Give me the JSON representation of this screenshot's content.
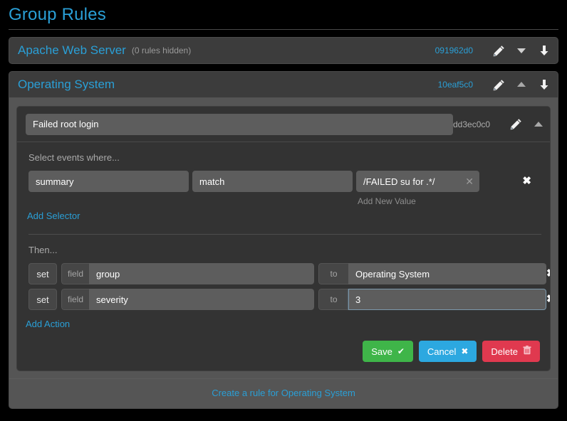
{
  "page": {
    "title": "Group Rules"
  },
  "groups": [
    {
      "name": "Apache Web Server",
      "hidden_note": "(0 rules hidden)",
      "id": "091962d0",
      "collapsed": true,
      "toggle_icon": "chevron-down-icon",
      "edit_icon": "pencil-icon",
      "move_icon": "arrow-down-icon"
    },
    {
      "name": "Operating System",
      "id": "10eaf5c0",
      "collapsed": false,
      "toggle_icon": "chevron-up-icon",
      "edit_icon": "pencil-icon",
      "move_icon": "arrow-down-icon",
      "create_rule_label": "Create a rule for Operating System",
      "rule": {
        "name": "Failed root login",
        "id": "dd3ec0c0",
        "edit_icon": "pencil-icon",
        "toggle_icon": "chevron-up-icon",
        "selector_section_label": "Select events where...",
        "selectors": [
          {
            "field": "summary",
            "operator": "match",
            "value": "/FAILED su for .*/",
            "value_clear_icon": "x-icon",
            "add_value_label": "Add New Value",
            "remove_icon": "x-icon"
          }
        ],
        "add_selector_label": "Add Selector",
        "action_section_label": "Then...",
        "actions": [
          {
            "verb": "set",
            "target_addon": "field",
            "target": "group",
            "value_addon": "to",
            "value": "Operating System",
            "remove_icon": "x-icon",
            "focused": false
          },
          {
            "verb": "set",
            "target_addon": "field",
            "target": "severity",
            "value_addon": "to",
            "value": "3",
            "remove_icon": "x-icon",
            "focused": true
          }
        ],
        "add_action_label": "Add Action",
        "buttons": {
          "save": "Save",
          "save_icon": "check-icon",
          "cancel": "Cancel",
          "cancel_icon": "x-icon",
          "delete": "Delete",
          "delete_icon": "trash-icon"
        }
      }
    }
  ],
  "colors": {
    "accent": "#2a9fd6",
    "save": "#3fb549",
    "cancel": "#2ca8e0",
    "delete": "#e0394f",
    "background": "#000000",
    "panel": "#3c3c3c",
    "panel_body": "#555555",
    "card": "#333333",
    "input": "#5d5d5d"
  }
}
